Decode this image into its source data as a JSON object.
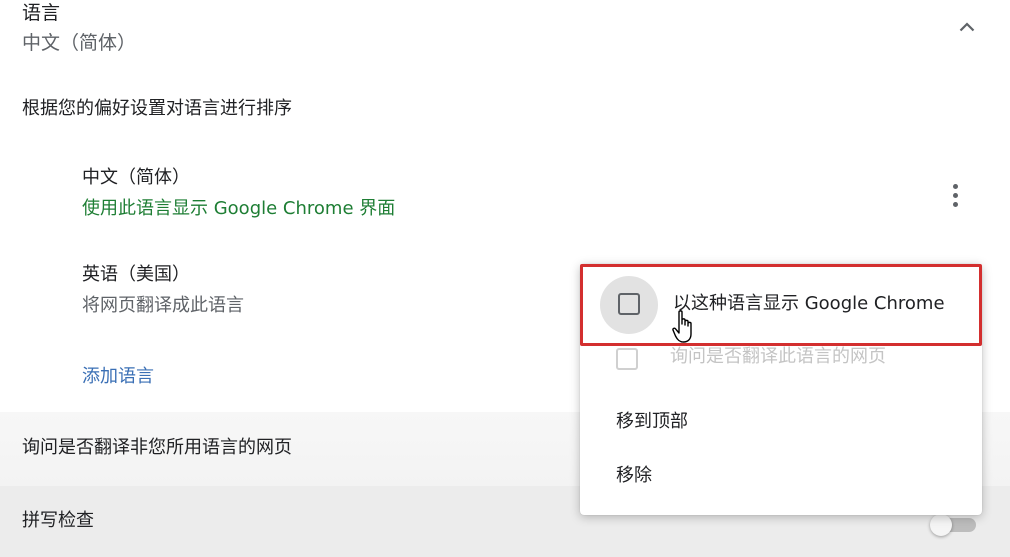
{
  "section": {
    "title": "语言",
    "subtitle": "中文（简体）"
  },
  "sort_heading": "根据您的偏好设置对语言进行排序",
  "languages": [
    {
      "name": "中文（简体）",
      "description": "使用此语言显示 Google Chrome 界面"
    },
    {
      "name": "英语（美国）",
      "description": "将网页翻译成此语言"
    }
  ],
  "add_language": "添加语言",
  "ask_translate": "询问是否翻译非您所用语言的网页",
  "spellcheck": "拼写检查",
  "menu": {
    "display_in_language": "以这种语言显示 Google Chrome",
    "offer_translate": "询问是否翻译此语言的网页",
    "move_to_top": "移到顶部",
    "remove": "移除"
  },
  "colors": {
    "highlight_border": "#d32f2f",
    "description_green": "#1e7e34",
    "link_blue": "#3a6fb5"
  },
  "icons": [
    "chevron-up-icon",
    "more-vert-icon",
    "hand-pointer-cursor-icon"
  ]
}
